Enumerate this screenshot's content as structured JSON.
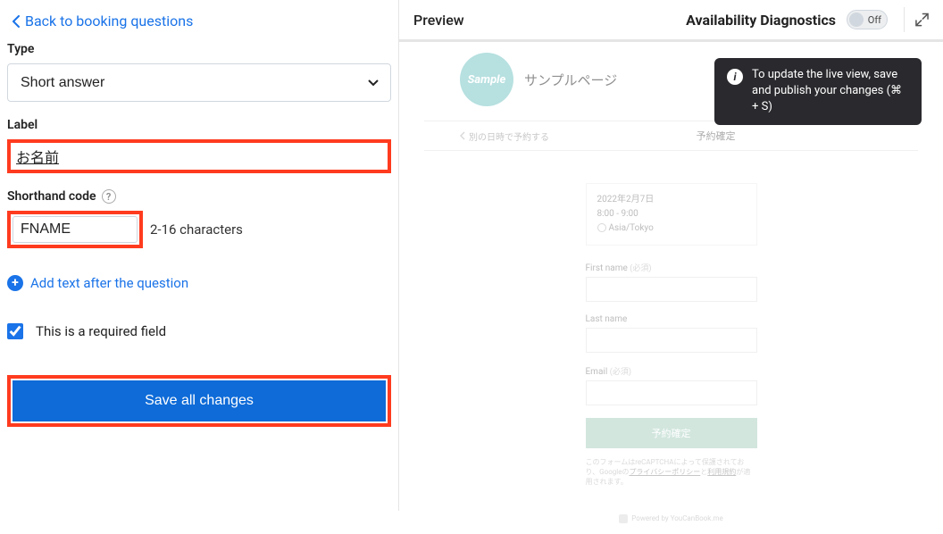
{
  "left": {
    "back_label": "Back to booking questions",
    "type_label": "Type",
    "type_value": "Short answer",
    "label_label": "Label",
    "label_value": "お名前",
    "shorthand_label": "Shorthand code",
    "shorthand_value": "FNAME",
    "shorthand_hint": "2-16 characters",
    "add_text_label": "Add text after the question",
    "required_label": "This is a required field",
    "save_label": "Save all changes"
  },
  "preview": {
    "title": "Preview",
    "diagnostics_label": "Availability Diagnostics",
    "toggle_state": "Off",
    "tooltip_text": "To update the live view, save and publish your changes (⌘ + S)",
    "sample_logo_text": "Sample",
    "sample_page_title": "サンプルページ",
    "sample_back_label": "別の日時で予約する",
    "sample_header": "予約確定",
    "booking_date": "2022年2月7日",
    "booking_time": "8:00 - 9:00",
    "booking_tz": "Asia/Tokyo",
    "first_name_label": "First name",
    "required_tag": "(必須)",
    "last_name_label": "Last name",
    "email_label": "Email",
    "confirm_button": "予約確定",
    "recaptcha_prefix": "このフォームはreCAPTCHAによって保護されており、Googleの",
    "recaptcha_link1": "プライバシーポリシー",
    "recaptcha_and": "と",
    "recaptcha_link2": "利用規約",
    "recaptcha_suffix": "が適用されます。",
    "powered_by": "Powered by YouCanBook.me"
  }
}
